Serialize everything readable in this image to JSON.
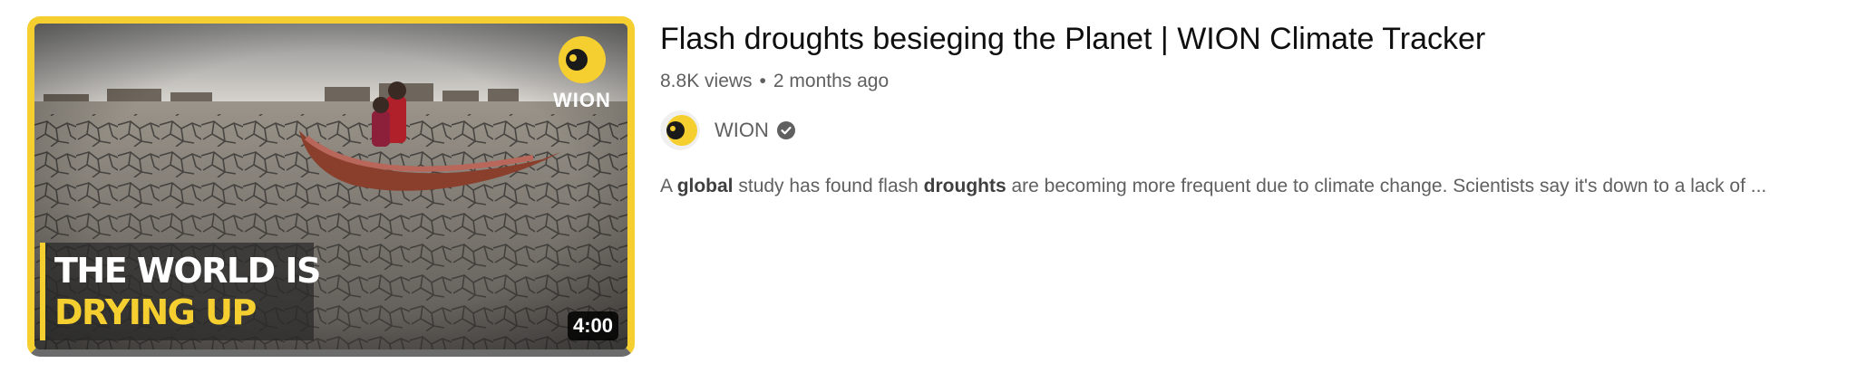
{
  "video": {
    "title": "Flash droughts besieging the Planet | WION Climate Tracker",
    "views": "8.8K views",
    "separator": "•",
    "age": "2 months ago",
    "duration": "4:00",
    "thumbnail": {
      "caption_line1": "THE WORLD IS",
      "caption_line2": "DRYING UP",
      "logo_text": "WION",
      "accent_color": "#f5cf30"
    }
  },
  "channel": {
    "name": "WION",
    "verified_icon": "verified-check-icon",
    "avatar_icon": "wion-avatar-icon"
  },
  "description": {
    "t1": "A ",
    "b1": "global",
    "t2": " study has found flash ",
    "b2": "droughts",
    "t3": " are becoming more frequent due to climate change. Scientists say it's down to a lack of ..."
  }
}
